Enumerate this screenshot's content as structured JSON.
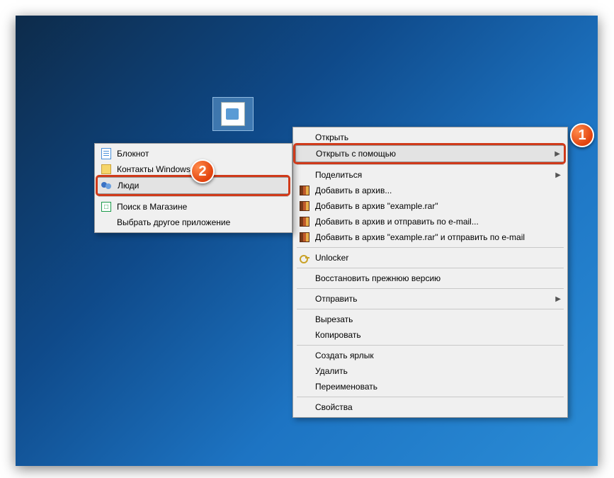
{
  "badges": {
    "one": "1",
    "two": "2"
  },
  "contextMenu": {
    "open": "Открыть",
    "openWith": "Открыть с помощью",
    "share": "Поделиться",
    "addArchive": "Добавить в архив...",
    "addArchiveNamed": "Добавить в архив \"example.rar\"",
    "addArchiveEmail": "Добавить в архив и отправить по e-mail...",
    "addArchiveNamedEmail": "Добавить в архив \"example.rar\" и отправить по e-mail",
    "unlocker": "Unlocker",
    "restorePrev": "Восстановить прежнюю версию",
    "sendTo": "Отправить",
    "cut": "Вырезать",
    "copy": "Копировать",
    "createShortcut": "Создать ярлык",
    "delete": "Удалить",
    "rename": "Переименовать",
    "properties": "Свойства"
  },
  "openWithMenu": {
    "notepad": "Блокнот",
    "contacts": "Контакты Windows",
    "people": "Люди",
    "storeSearch": "Поиск в Магазине",
    "chooseOther": "Выбрать другое приложение"
  }
}
